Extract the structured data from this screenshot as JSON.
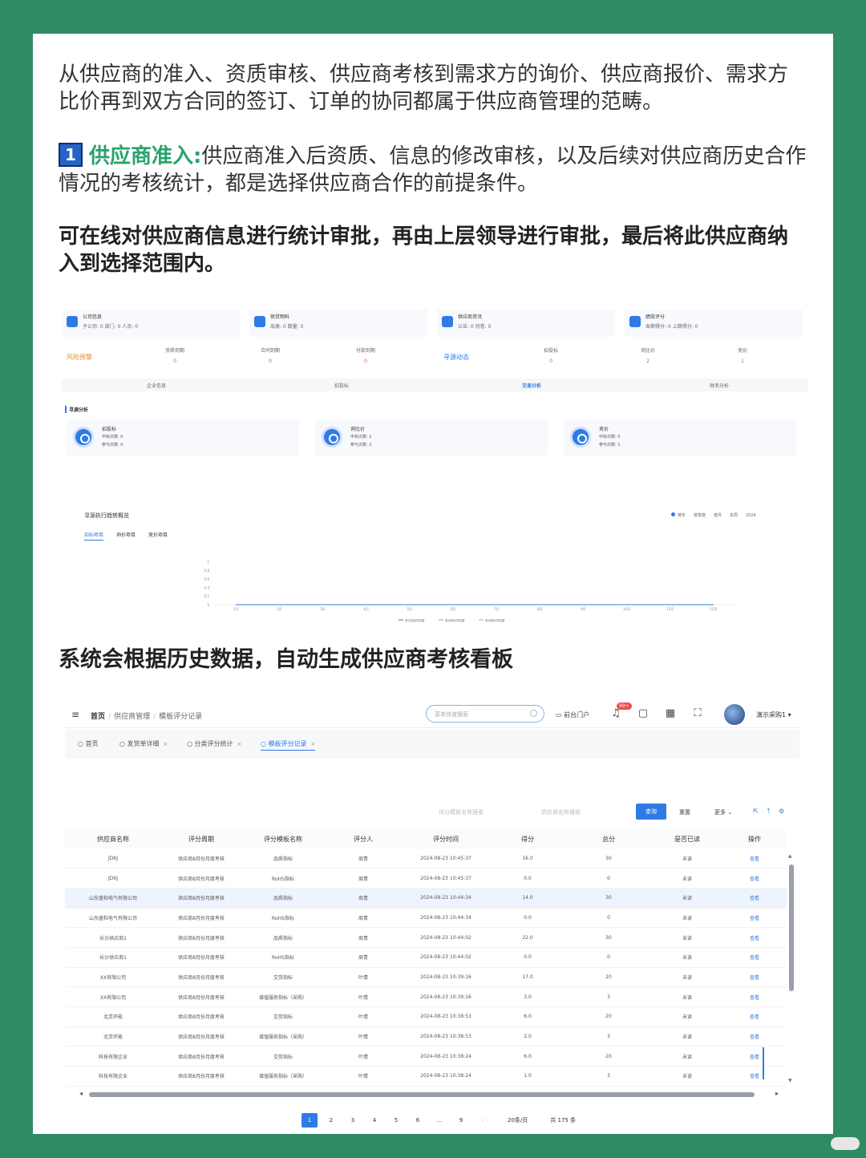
{
  "intro": "从供应商的准入、资质审核、供应商考核到需求方的询价、供应商报价、需求方比价再到双方合同的签订、订单的协同都属于供应商管理的范畴。",
  "section1": {
    "number": "1",
    "title": "供应商准入:",
    "text": "供应商准入后资质、信息的修改审核，以及后续对供应商历史合作情况的考核统计，都是选择供应商合作的前提条件。"
  },
  "bold_para": "可在线对供应商信息进行统计审批，再由上层领导进行审批，最后将此供应商纳入到选择范围内。",
  "heading2": "系统会根据历史数据，自动生成供应商考核看板",
  "dashboard": {
    "stat_cards": [
      {
        "title": "公司信息",
        "sub": "子公司: 0   部门: 0   人员: 0"
      },
      {
        "title": "供货物料",
        "sub": "品类: 0   数量: 0"
      },
      {
        "title": "供应商资讯",
        "sub": "公告: 0   问卷: 0"
      },
      {
        "title": "绩效评分",
        "sub": "本期得分: 0   上期得分: 0"
      }
    ],
    "risk_label": "风险预警",
    "risk_items": [
      {
        "label": "资质到期",
        "value": "0"
      },
      {
        "label": "合同到期",
        "value": "0"
      },
      {
        "label": "付款到期",
        "value": "0"
      }
    ],
    "sourcing_label": "寻源动态",
    "sourcing_items": [
      {
        "label": "招投标",
        "value": "0"
      },
      {
        "label": "询比价",
        "value": "2"
      },
      {
        "label": "竞价",
        "value": "1"
      }
    ],
    "tabs": [
      "企业信息",
      "招投标",
      "交易分析",
      "财务分析"
    ],
    "section_title": "寻源分析",
    "kpi_cards": [
      {
        "title": "招投标",
        "line1": "中标次数: 0",
        "line2": "参与次数: 0"
      },
      {
        "title": "询比价",
        "line1": "中标次数: 1",
        "line2": "参与次数: 2"
      },
      {
        "title": "竞价",
        "line1": "中标次数: 0",
        "line2": "参与次数: 1"
      }
    ],
    "trend_title": "寻源执行趋势概览",
    "trend_filters": [
      "按年",
      "按季度",
      "按月",
      "本周",
      "2024"
    ],
    "sub_tabs": [
      "招标项目",
      "询价项目",
      "竞价项目"
    ],
    "legend": [
      "参与招标项目数",
      "参与询价项目数",
      "参与竞价项目数"
    ]
  },
  "chart_data": {
    "type": "line",
    "categories": [
      "1月",
      "2月",
      "3月",
      "4月",
      "5月",
      "6月",
      "7月",
      "8月",
      "9月",
      "10月",
      "11月",
      "12月"
    ],
    "y_ticks": [
      "1",
      "0.8",
      "0.6",
      "0.4",
      "0.2",
      "0"
    ],
    "ylim": [
      0,
      1
    ],
    "series": [
      {
        "name": "参与招标项目数",
        "color": "#2f7be6",
        "values": [
          0,
          0,
          0,
          0,
          0,
          0,
          0,
          0,
          0,
          0,
          0,
          0
        ]
      },
      {
        "name": "参与询价项目数",
        "color": "#9aa0a8",
        "values": [
          0,
          0,
          0,
          0,
          0,
          0,
          0,
          0,
          0,
          0,
          0,
          0
        ]
      },
      {
        "name": "参与竞价项目数",
        "color": "#f0a23a",
        "values": [
          0,
          0,
          0,
          0,
          0,
          0,
          0,
          0,
          0,
          0,
          0,
          0
        ]
      }
    ]
  },
  "app": {
    "breadcrumb": [
      "首页",
      "供应商管理",
      "模板评分记录"
    ],
    "search_placeholder": "菜单快速搜索",
    "portal": "前台门户",
    "notif_badge": "99+",
    "user": "演示采购1 ▾",
    "tags": [
      "首页",
      "发货单详细",
      "分类评分统计",
      "模板评分记录"
    ],
    "filters": [
      "评分模板名称搜索",
      "供应商名称搜索"
    ],
    "btn_query": "查询",
    "btn_reset": "重置",
    "btn_more": "更多 ⌄",
    "columns": [
      "供应商名称",
      "评分周期",
      "评分模板名称",
      "评分人",
      "评分时间",
      "得分",
      "总分",
      "是否已读",
      "操作"
    ],
    "rows": [
      [
        "JDKJ",
        "供应商8月份月度考核",
        "品质指标",
        "周青",
        "2024-08-23 10:45:37",
        "16.0",
        "30",
        "未读",
        "查看"
      ],
      [
        "JDKJ",
        "供应商8月份月度考核",
        "RoHS指标",
        "周青",
        "2024-08-23 10:45:37",
        "0.0",
        "0",
        "未读",
        "查看"
      ],
      [
        "山东盛和电气有限公司",
        "供应商8月份月度考核",
        "品质指标",
        "周青",
        "2024-08-23 10:44:34",
        "14.0",
        "30",
        "未读",
        "查看"
      ],
      [
        "山东盛和电气有限公司",
        "供应商8月份月度考核",
        "RoHS指标",
        "周青",
        "2024-08-23 10:44:34",
        "0.0",
        "0",
        "未读",
        "查看"
      ],
      [
        "长沙供应商1",
        "供应商8月份月度考核",
        "品质指标",
        "周青",
        "2024-08-23 10:44:02",
        "22.0",
        "30",
        "未读",
        "查看"
      ],
      [
        "长沙供应商1",
        "供应商8月份月度考核",
        "RoHS指标",
        "周青",
        "2024-08-23 10:44:02",
        "0.0",
        "0",
        "未读",
        "查看"
      ],
      [
        "XX有限公司",
        "供应商8月份月度考核",
        "交货指标",
        "叶倩",
        "2024-08-23 10:39:16",
        "17.0",
        "20",
        "未读",
        "查看"
      ],
      [
        "XX有限公司",
        "供应商8月份月度考核",
        "增值服务指标（采购）",
        "叶倩",
        "2024-08-23 10:39:16",
        "3.0",
        "3",
        "未读",
        "查看"
      ],
      [
        "北京环能",
        "供应商8月份月度考核",
        "交货指标",
        "叶倩",
        "2024-08-23 10:38:53",
        "6.0",
        "20",
        "未读",
        "查看"
      ],
      [
        "北京环能",
        "供应商8月份月度考核",
        "增值服务指标（采购）",
        "叶倩",
        "2024-08-23 10:38:53",
        "2.0",
        "3",
        "未读",
        "查看"
      ],
      [
        "科技有限企业",
        "供应商8月份月度考核",
        "交货指标",
        "叶倩",
        "2024-08-23 10:38:24",
        "6.0",
        "20",
        "未读",
        "查看"
      ],
      [
        "科技有限企业",
        "供应商8月份月度考核",
        "增值服务指标（采购）",
        "叶倩",
        "2024-08-23 10:38:24",
        "1.0",
        "3",
        "未读",
        "查看"
      ]
    ],
    "pager": {
      "prev": "‹",
      "pages": [
        "1",
        "2",
        "3",
        "4",
        "5",
        "6",
        "...",
        "9"
      ],
      "next": "›",
      "page_size": "20条/页",
      "total": "共 175 条"
    }
  }
}
